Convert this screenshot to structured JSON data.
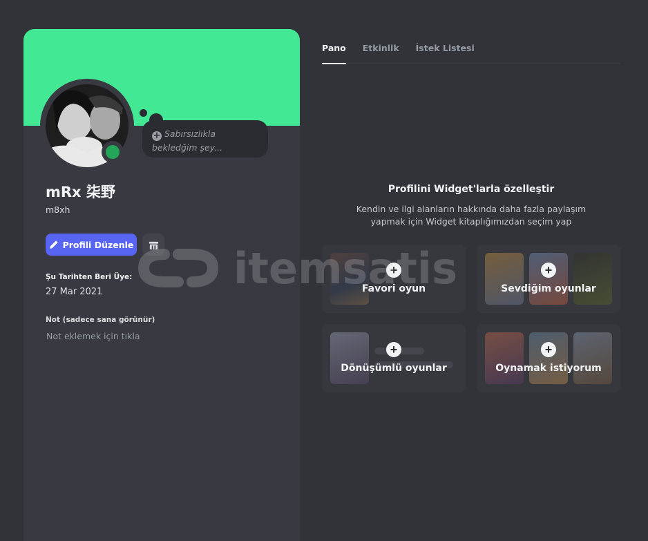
{
  "profile": {
    "display_name": "mRx 柒野",
    "username": "m8xh",
    "custom_status_placeholder": "Sabırsızlıkla bekledğim şey...",
    "status": "online",
    "banner_color": "#43e894",
    "edit_button_label": "Profili Düzenle",
    "member_since_label": "Şu Tarihten Beri Üye:",
    "member_since_value": "27 Mar 2021",
    "note_label": "Not (sadece sana görünür)",
    "note_placeholder": "Not eklemek için tıkla"
  },
  "tabs": [
    {
      "label": "Pano",
      "active": true
    },
    {
      "label": "Etkinlik",
      "active": false
    },
    {
      "label": "İstek Listesi",
      "active": false
    }
  ],
  "widgets": {
    "title": "Profilini Widget'larla özelleştir",
    "description": "Kendin ve ilgi alanların hakkında daha fazla paylaşım yapmak için Widget kitaplığımızdan seçim yap",
    "cards": [
      {
        "label": "Favori oyun",
        "icon": "plus-icon"
      },
      {
        "label": "Sevdiğim oyunlar",
        "icon": "plus-icon"
      },
      {
        "label": "Dönüşümlü oyunlar",
        "icon": "plus-icon"
      },
      {
        "label": "Oynamak istiyorum",
        "icon": "plus-icon"
      }
    ]
  },
  "colors": {
    "background": "#323339",
    "card": "#393a41",
    "accent": "#5865f2",
    "online": "#23a55a"
  },
  "watermark": {
    "text": "itemsatis"
  }
}
